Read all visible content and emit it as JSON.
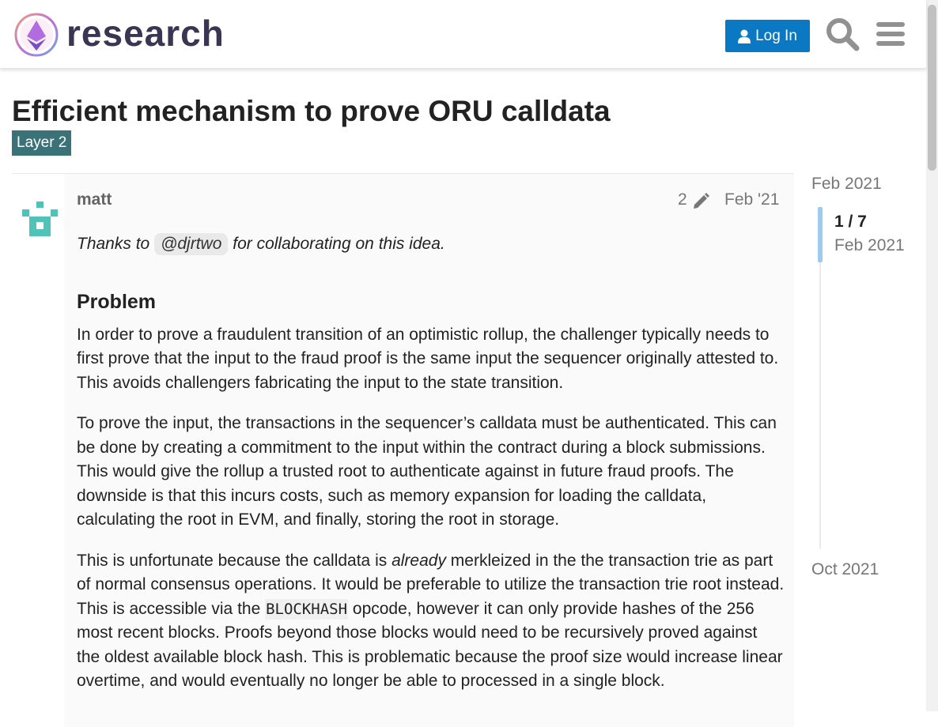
{
  "header": {
    "logo_text": "research",
    "login_label": "Log In",
    "search_icon": "search-icon",
    "menu_icon": "hamburger-icon",
    "login_color": "#0a78c2"
  },
  "topic": {
    "title": "Efficient mechanism to prove ORU calldata",
    "category": "Layer 2",
    "category_color": "#3b7278"
  },
  "post": {
    "author": "matt",
    "edit_count": "2",
    "date": "Feb '21",
    "intro_before": "Thanks to ",
    "mention": "@djrtwo",
    "intro_after": " for collaborating on this idea.",
    "heading": "Problem",
    "p1": "In order to prove a fraudulent transition of an optimistic rollup, the challenger typically needs to first prove that the input to the fraud proof is the same input the sequencer originally attested to. This avoids challengers fabricating the input to the state transition.",
    "p2": "To prove the input, the transactions in the sequencer’s calldata must be authenticated. This can be done by creating a commitment to the input within the contract during a block submissions. This would give the rollup a trusted root to authenticate against in future fraud proofs. The downside is that this incurs costs, such as memory expansion for loading the calldata, calculating the root in EVM, and finally, storing the root in storage.",
    "p3_a": "This is unfortunate because the calldata is ",
    "p3_em": "already",
    "p3_b": " merkleized in the the transaction trie as part of normal consensus operations. It would be preferable to utilize the transaction trie root instead. This is accessible via the ",
    "p3_code": "BLOCKHASH",
    "p3_c": " opcode, however it can only provide hashes of the 256 most recent blocks. Proofs beyond those blocks would need to be recursively proved against the oldest available block hash. This is problematic because the proof size would increase linear overtime, and would eventually no longer be able to processed in a single block."
  },
  "timeline": {
    "start": "Feb 2021",
    "position": "1 / 7",
    "position_date": "Feb 2021",
    "end": "Oct 2021"
  }
}
